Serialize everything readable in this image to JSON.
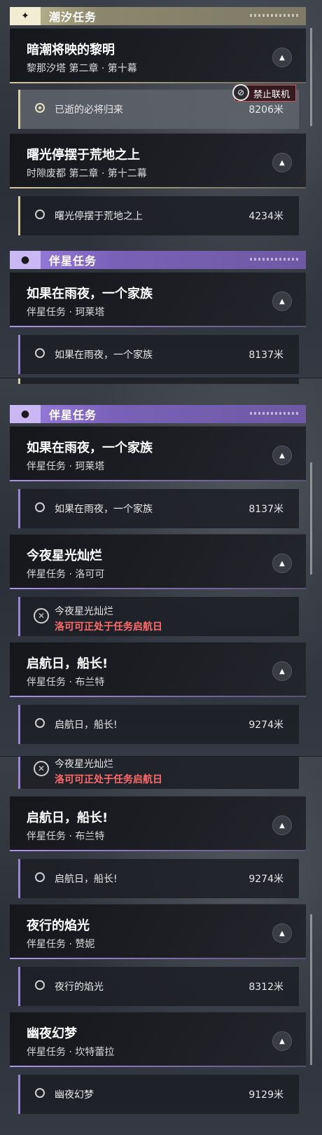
{
  "sections": {
    "tide": {
      "title": "潮汐任务",
      "icon": "sparkle-icon"
    },
    "companion": {
      "title": "伴星任务",
      "icon": "person-icon"
    }
  },
  "panel1": {
    "card1": {
      "title": "暗潮将映的黎明",
      "subtitle": "黎那汐塔 第二章 · 第十幕"
    },
    "row1": {
      "label": "已逝的必将归来",
      "distance": "8206米"
    },
    "tag": {
      "label": "禁止联机"
    },
    "card2": {
      "title": "曙光停摆于荒地之上",
      "subtitle": "时隙废都 第二章 · 第十二幕"
    },
    "row2": {
      "label": "曙光停摆于荒地之上",
      "distance": "4234米"
    },
    "card3": {
      "title": "如果在雨夜，一个家族",
      "subtitle": "伴星任务 · 珂莱塔"
    },
    "row3": {
      "label": "如果在雨夜，一个家族",
      "distance": "8137米"
    }
  },
  "panel2": {
    "card1": {
      "title": "如果在雨夜，一个家族",
      "subtitle": "伴星任务 · 珂莱塔"
    },
    "row1": {
      "label": "如果在雨夜，一个家族",
      "distance": "8137米"
    },
    "card2": {
      "title": "今夜星光灿烂",
      "subtitle": "伴星任务 · 洛可可"
    },
    "row2": {
      "label": "今夜星光灿烂",
      "warning": "洛可可正处于任务启航日"
    },
    "card3": {
      "title": "启航日，船长!",
      "subtitle": "伴星任务 · 布兰特"
    },
    "row3": {
      "label": "启航日，船长!",
      "distance": "9274米"
    }
  },
  "panel3": {
    "row0": {
      "label": "今夜星光灿烂",
      "warning": "洛可可正处于任务启航日"
    },
    "card1": {
      "title": "启航日，船长!",
      "subtitle": "伴星任务 · 布兰特"
    },
    "row1": {
      "label": "启航日，船长!",
      "distance": "9274米"
    },
    "card2": {
      "title": "夜行的焰光",
      "subtitle": "伴星任务 · 赞妮"
    },
    "row2": {
      "label": "夜行的焰光",
      "distance": "8312米"
    },
    "card3": {
      "title": "幽夜幻梦",
      "subtitle": "伴星任务 · 坎特蕾拉"
    },
    "row3": {
      "label": "幽夜幻梦",
      "distance": "9129米"
    }
  }
}
